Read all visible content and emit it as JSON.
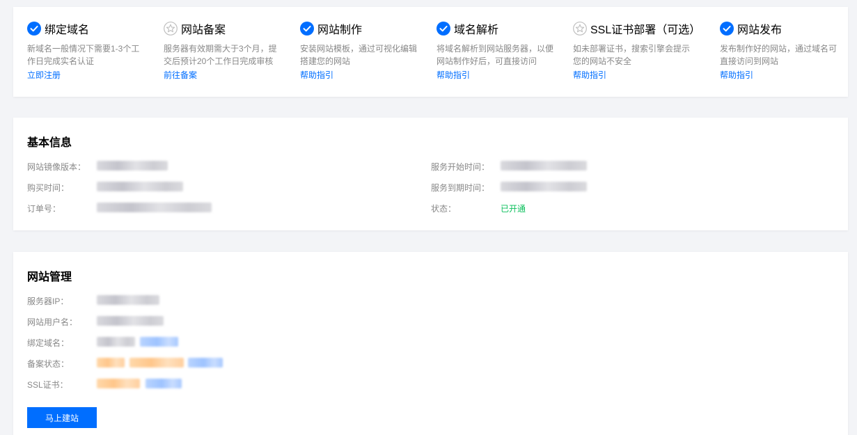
{
  "steps": [
    {
      "title": "绑定域名",
      "desc": "新域名一般情况下需要1-3个工作日完成实名认证",
      "link": "立即注册",
      "icon": "check-circle-icon",
      "done": true
    },
    {
      "title": "网站备案",
      "desc": "服务器有效期需大于3个月，提交后预计20个工作日完成审核",
      "link": "前往备案",
      "icon": "star-circle-icon",
      "done": false
    },
    {
      "title": "网站制作",
      "desc": "安装网站模板，通过可视化编辑搭建您的网站",
      "link": "帮助指引",
      "icon": "check-circle-icon",
      "done": true
    },
    {
      "title": "域名解析",
      "desc": "将域名解析到网站服务器，以便网站制作好后，可直接访问",
      "link": "帮助指引",
      "icon": "check-circle-icon",
      "done": true
    },
    {
      "title": "SSL证书部署（可选）",
      "desc": "如未部署证书，搜索引擎会提示您的网站不安全",
      "link": "帮助指引",
      "icon": "star-circle-icon",
      "done": false
    },
    {
      "title": "网站发布",
      "desc": "发布制作好的网站，通过域名可直接访问到网站",
      "link": "帮助指引",
      "icon": "check-circle-icon",
      "done": true
    }
  ],
  "basic_info": {
    "title": "基本信息",
    "labels": {
      "image_version": "网站镜像版本：",
      "purchase_time": "购买时间：",
      "order_no": "订单号：",
      "service_start": "服务开始时间：",
      "service_end": "服务到期时间：",
      "status": "状态："
    },
    "status_value": "已开通"
  },
  "site_management": {
    "title": "网站管理",
    "labels": {
      "server_ip": "服务器IP：",
      "site_username": "网站用户名：",
      "bound_domain": "绑定域名：",
      "filing_status": "备案状态：",
      "ssl_cert": "SSL证书："
    },
    "build_button": "马上建站"
  },
  "colors": {
    "accent": "#006eff",
    "success": "#0abf5b",
    "muted": "#888888",
    "background": "#f3f4f7"
  }
}
